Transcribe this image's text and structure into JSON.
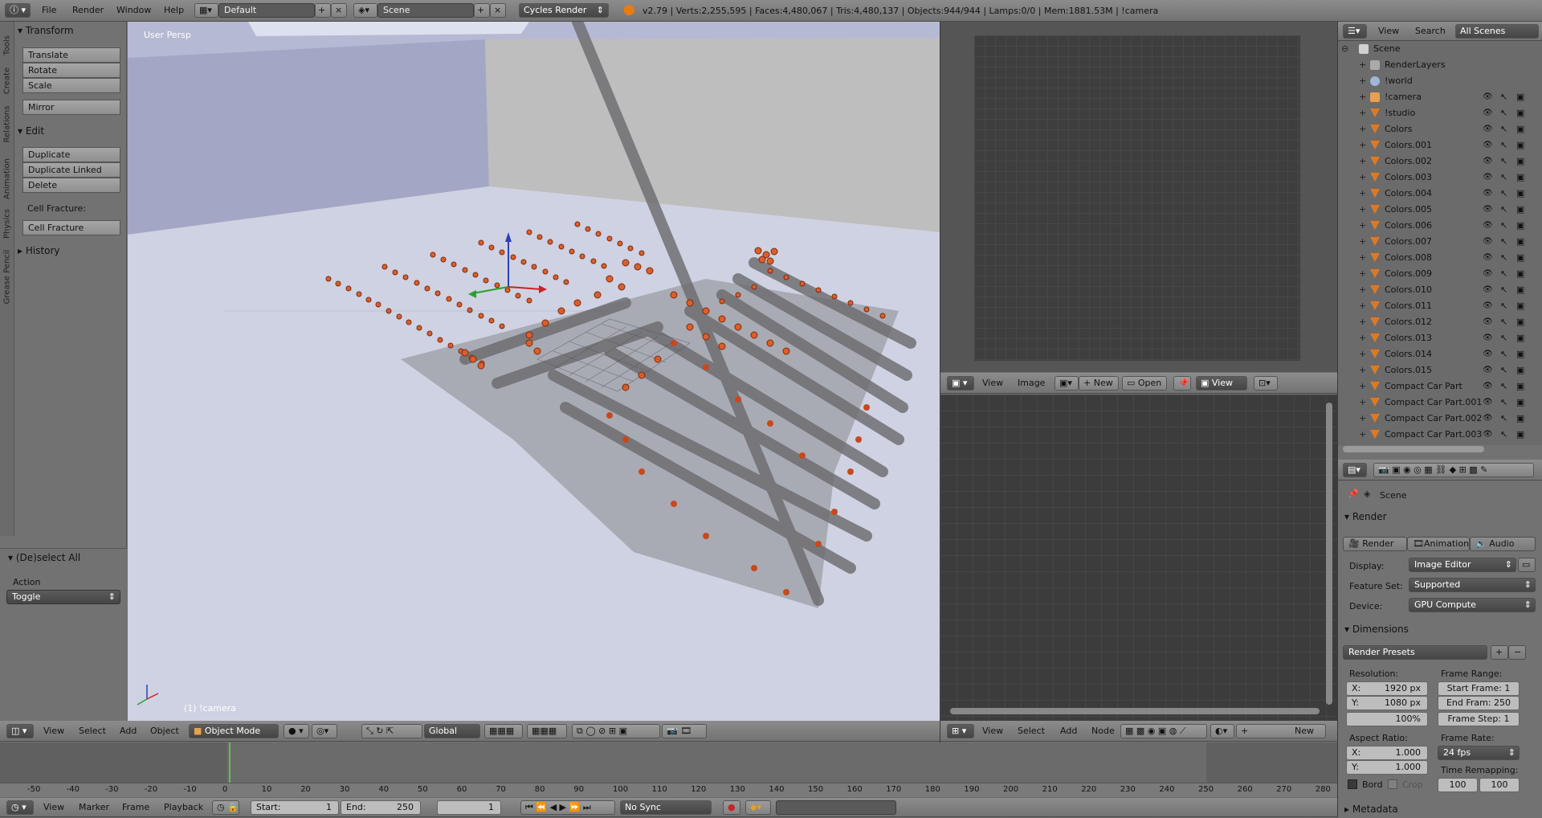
{
  "top_menu": {
    "file": "File",
    "render": "Render",
    "window": "Window",
    "help": "Help",
    "layout": "Default",
    "scene": "Scene",
    "engine": "Cycles Render",
    "stats": "v2.79 | Verts:2,255,595 | Faces:4,480,067 | Tris:4,480,137 | Objects:944/944 | Lamps:0/0 | Mem:1881.53M | !camera"
  },
  "tool_tabs": [
    "Tools",
    "Create",
    "Relations",
    "Animation",
    "Physics",
    "Grease Pencil"
  ],
  "tool_shelf": {
    "transform_title": "Transform",
    "translate": "Translate",
    "rotate": "Rotate",
    "scale": "Scale",
    "mirror": "Mirror",
    "edit_title": "Edit",
    "duplicate": "Duplicate",
    "duplicate_linked": "Duplicate Linked",
    "delete": "Delete",
    "cell_fracture_label": "Cell Fracture:",
    "cell_fracture": "Cell Fracture",
    "history_title": "History",
    "operator_title": "(De)select All",
    "action_label": "Action",
    "action_value": "Toggle"
  },
  "viewport": {
    "view_name": "User Persp",
    "object_label": "(1) !camera",
    "menu_view": "View",
    "menu_select": "Select",
    "menu_add": "Add",
    "menu_object": "Object",
    "mode": "Object Mode",
    "orientation": "Global"
  },
  "image_editor": {
    "view": "View",
    "image": "Image",
    "new": "New",
    "open": "Open",
    "view2": "View"
  },
  "node_editor": {
    "view": "View",
    "select": "Select",
    "add": "Add",
    "node": "Node",
    "new": "New"
  },
  "timeline": {
    "ticks": [
      "-50",
      "-40",
      "-30",
      "-20",
      "-10",
      "0",
      "10",
      "20",
      "30",
      "40",
      "50",
      "60",
      "70",
      "80",
      "90",
      "100",
      "110",
      "120",
      "130",
      "140",
      "150",
      "160",
      "170",
      "180",
      "190",
      "200",
      "210",
      "220",
      "230",
      "240",
      "250",
      "260",
      "270",
      "280"
    ],
    "current_frame": 1,
    "menu_view": "View",
    "menu_marker": "Marker",
    "menu_frame": "Frame",
    "menu_playback": "Playback",
    "start_label": "Start:",
    "start_value": "1",
    "end_label": "End:",
    "end_value": "250",
    "frame_value": "1",
    "sync": "No Sync"
  },
  "outliner": {
    "view": "View",
    "search": "Search",
    "scope": "All Scenes",
    "items": [
      {
        "label": "Scene",
        "type": "scene"
      },
      {
        "label": "RenderLayers",
        "type": "renderlayers"
      },
      {
        "label": "!world",
        "type": "world"
      },
      {
        "label": "!camera",
        "type": "camera"
      },
      {
        "label": "!studio",
        "type": "mesh"
      },
      {
        "label": "Colors",
        "type": "mesh"
      },
      {
        "label": "Colors.001",
        "type": "mesh"
      },
      {
        "label": "Colors.002",
        "type": "mesh"
      },
      {
        "label": "Colors.003",
        "type": "mesh"
      },
      {
        "label": "Colors.004",
        "type": "mesh"
      },
      {
        "label": "Colors.005",
        "type": "mesh"
      },
      {
        "label": "Colors.006",
        "type": "mesh"
      },
      {
        "label": "Colors.007",
        "type": "mesh"
      },
      {
        "label": "Colors.008",
        "type": "mesh"
      },
      {
        "label": "Colors.009",
        "type": "mesh"
      },
      {
        "label": "Colors.010",
        "type": "mesh"
      },
      {
        "label": "Colors.011",
        "type": "mesh"
      },
      {
        "label": "Colors.012",
        "type": "mesh"
      },
      {
        "label": "Colors.013",
        "type": "mesh"
      },
      {
        "label": "Colors.014",
        "type": "mesh"
      },
      {
        "label": "Colors.015",
        "type": "mesh"
      },
      {
        "label": "Compact Car Part",
        "type": "mesh"
      },
      {
        "label": "Compact Car Part.001",
        "type": "mesh"
      },
      {
        "label": "Compact Car Part.002",
        "type": "mesh"
      },
      {
        "label": "Compact Car Part.003",
        "type": "mesh"
      }
    ]
  },
  "properties": {
    "context": "Scene",
    "render_title": "Render",
    "btn_render": "Render",
    "btn_animation": "Animation",
    "btn_audio": "Audio",
    "display_label": "Display:",
    "display_value": "Image Editor",
    "feature_label": "Feature Set:",
    "feature_value": "Supported",
    "device_label": "Device:",
    "device_value": "GPU Compute",
    "dimensions_title": "Dimensions",
    "render_presets": "Render Presets",
    "resolution_label": "Resolution:",
    "res_x_label": "X:",
    "res_x": "1920 px",
    "res_y_label": "Y:",
    "res_y": "1080 px",
    "res_pct": "100%",
    "frame_range_label": "Frame Range:",
    "start_frame": "Start Frame: 1",
    "end_frame": "End Fram: 250",
    "frame_step": "Frame Step: 1",
    "aspect_label": "Aspect Ratio:",
    "asp_x_label": "X:",
    "asp_x": "1.000",
    "asp_y_label": "Y:",
    "asp_y": "1.000",
    "frame_rate_label": "Frame Rate:",
    "frame_rate": "24 fps",
    "time_remap_label": "Time Remapping:",
    "remap_old": "100",
    "remap_new": "100",
    "border_label": "Bord",
    "crop_label": "Crop",
    "metadata_title": "Metadata"
  }
}
